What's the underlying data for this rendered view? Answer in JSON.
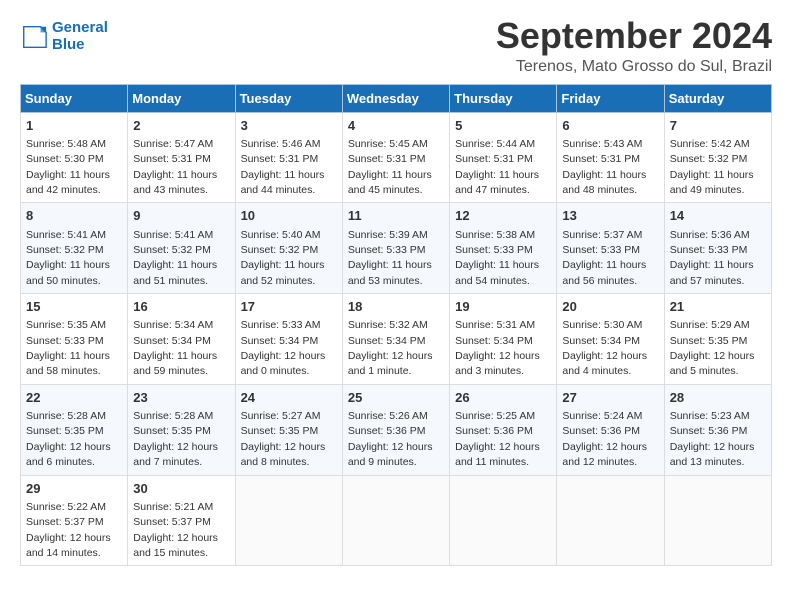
{
  "logo": {
    "line1": "General",
    "line2": "Blue"
  },
  "title": "September 2024",
  "subtitle": "Terenos, Mato Grosso do Sul, Brazil",
  "weekdays": [
    "Sunday",
    "Monday",
    "Tuesday",
    "Wednesday",
    "Thursday",
    "Friday",
    "Saturday"
  ],
  "weeks": [
    [
      {
        "day": 1,
        "sunrise": "5:48 AM",
        "sunset": "5:30 PM",
        "daylight": "11 hours and 42 minutes."
      },
      {
        "day": 2,
        "sunrise": "5:47 AM",
        "sunset": "5:31 PM",
        "daylight": "11 hours and 43 minutes."
      },
      {
        "day": 3,
        "sunrise": "5:46 AM",
        "sunset": "5:31 PM",
        "daylight": "11 hours and 44 minutes."
      },
      {
        "day": 4,
        "sunrise": "5:45 AM",
        "sunset": "5:31 PM",
        "daylight": "11 hours and 45 minutes."
      },
      {
        "day": 5,
        "sunrise": "5:44 AM",
        "sunset": "5:31 PM",
        "daylight": "11 hours and 47 minutes."
      },
      {
        "day": 6,
        "sunrise": "5:43 AM",
        "sunset": "5:31 PM",
        "daylight": "11 hours and 48 minutes."
      },
      {
        "day": 7,
        "sunrise": "5:42 AM",
        "sunset": "5:32 PM",
        "daylight": "11 hours and 49 minutes."
      }
    ],
    [
      {
        "day": 8,
        "sunrise": "5:41 AM",
        "sunset": "5:32 PM",
        "daylight": "11 hours and 50 minutes."
      },
      {
        "day": 9,
        "sunrise": "5:41 AM",
        "sunset": "5:32 PM",
        "daylight": "11 hours and 51 minutes."
      },
      {
        "day": 10,
        "sunrise": "5:40 AM",
        "sunset": "5:32 PM",
        "daylight": "11 hours and 52 minutes."
      },
      {
        "day": 11,
        "sunrise": "5:39 AM",
        "sunset": "5:33 PM",
        "daylight": "11 hours and 53 minutes."
      },
      {
        "day": 12,
        "sunrise": "5:38 AM",
        "sunset": "5:33 PM",
        "daylight": "11 hours and 54 minutes."
      },
      {
        "day": 13,
        "sunrise": "5:37 AM",
        "sunset": "5:33 PM",
        "daylight": "11 hours and 56 minutes."
      },
      {
        "day": 14,
        "sunrise": "5:36 AM",
        "sunset": "5:33 PM",
        "daylight": "11 hours and 57 minutes."
      }
    ],
    [
      {
        "day": 15,
        "sunrise": "5:35 AM",
        "sunset": "5:33 PM",
        "daylight": "11 hours and 58 minutes."
      },
      {
        "day": 16,
        "sunrise": "5:34 AM",
        "sunset": "5:34 PM",
        "daylight": "11 hours and 59 minutes."
      },
      {
        "day": 17,
        "sunrise": "5:33 AM",
        "sunset": "5:34 PM",
        "daylight": "12 hours and 0 minutes."
      },
      {
        "day": 18,
        "sunrise": "5:32 AM",
        "sunset": "5:34 PM",
        "daylight": "12 hours and 1 minute."
      },
      {
        "day": 19,
        "sunrise": "5:31 AM",
        "sunset": "5:34 PM",
        "daylight": "12 hours and 3 minutes."
      },
      {
        "day": 20,
        "sunrise": "5:30 AM",
        "sunset": "5:34 PM",
        "daylight": "12 hours and 4 minutes."
      },
      {
        "day": 21,
        "sunrise": "5:29 AM",
        "sunset": "5:35 PM",
        "daylight": "12 hours and 5 minutes."
      }
    ],
    [
      {
        "day": 22,
        "sunrise": "5:28 AM",
        "sunset": "5:35 PM",
        "daylight": "12 hours and 6 minutes."
      },
      {
        "day": 23,
        "sunrise": "5:28 AM",
        "sunset": "5:35 PM",
        "daylight": "12 hours and 7 minutes."
      },
      {
        "day": 24,
        "sunrise": "5:27 AM",
        "sunset": "5:35 PM",
        "daylight": "12 hours and 8 minutes."
      },
      {
        "day": 25,
        "sunrise": "5:26 AM",
        "sunset": "5:36 PM",
        "daylight": "12 hours and 9 minutes."
      },
      {
        "day": 26,
        "sunrise": "5:25 AM",
        "sunset": "5:36 PM",
        "daylight": "12 hours and 11 minutes."
      },
      {
        "day": 27,
        "sunrise": "5:24 AM",
        "sunset": "5:36 PM",
        "daylight": "12 hours and 12 minutes."
      },
      {
        "day": 28,
        "sunrise": "5:23 AM",
        "sunset": "5:36 PM",
        "daylight": "12 hours and 13 minutes."
      }
    ],
    [
      {
        "day": 29,
        "sunrise": "5:22 AM",
        "sunset": "5:37 PM",
        "daylight": "12 hours and 14 minutes."
      },
      {
        "day": 30,
        "sunrise": "5:21 AM",
        "sunset": "5:37 PM",
        "daylight": "12 hours and 15 minutes."
      },
      null,
      null,
      null,
      null,
      null
    ]
  ]
}
